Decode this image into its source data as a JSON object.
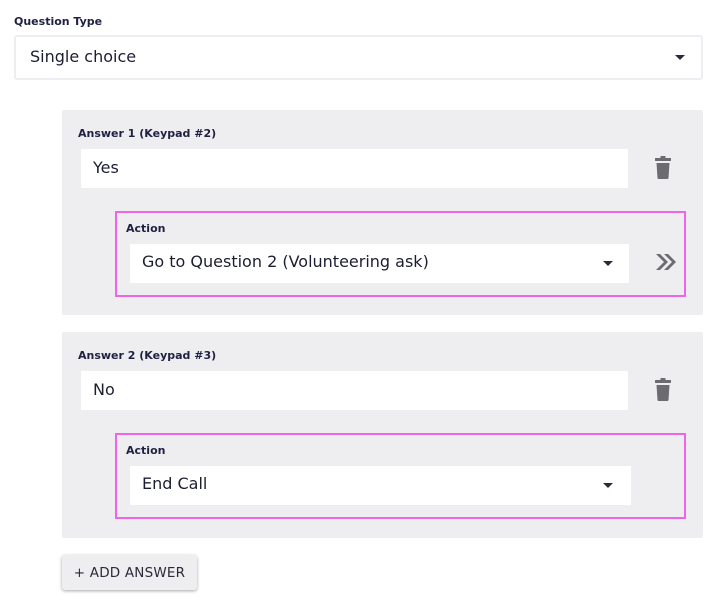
{
  "question_type": {
    "label": "Question Type",
    "selected": "Single choice"
  },
  "answers": [
    {
      "label": "Answer 1 (Keypad #2)",
      "value": "Yes",
      "action_label": "Action",
      "action_value": "Go to Question 2 (Volunteering ask)",
      "icons": [
        "trash-icon",
        "double-chevron-right-icon"
      ]
    },
    {
      "label": "Answer 2 (Keypad #3)",
      "value": "No",
      "action_label": "Action",
      "action_value": "End Call",
      "icons": [
        "trash-icon"
      ]
    }
  ],
  "add_answer_label": "+ ADD ANSWER",
  "colors": {
    "highlight_border": "#f064e8",
    "card_background": "#eeeef0",
    "icon_gray": "#6b6b70"
  }
}
